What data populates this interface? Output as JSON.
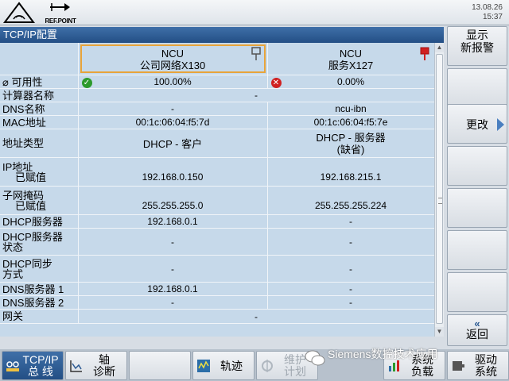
{
  "topbar": {
    "refpoint_label": "REF.POINT",
    "date": "13.08.26",
    "time": "15:37"
  },
  "title": "TCP/IP配置",
  "table": {
    "col1_header": [
      "NCU",
      "公司网络X130"
    ],
    "col2_header": [
      "NCU",
      "服务X127"
    ],
    "rows": {
      "availability": {
        "label": "⌀ 可用性",
        "v1": "100.00%",
        "v2": "0.00%"
      },
      "computer_name": {
        "label": "计算器名称",
        "v": "-"
      },
      "dns_name": {
        "label": "DNS名称",
        "v1": "-",
        "v2": "ncu-ibn"
      },
      "mac": {
        "label": "MAC地址",
        "v1": "00:1c:06:04:f5:7d",
        "v2": "00:1c:06:04:f5:7e"
      },
      "addr_type": {
        "label": "地址类型",
        "v1": "DHCP - 客户",
        "v2a": "DHCP - 服务器",
        "v2b": "(缺省)"
      },
      "ip": {
        "label1": "IP地址",
        "label2": "已赋值",
        "v1": "192.168.0.150",
        "v2": "192.168.215.1"
      },
      "subnet": {
        "label1": "子网掩码",
        "label2": "已赋值",
        "v1": "255.255.255.0",
        "v2": "255.255.255.224"
      },
      "dhcp_server": {
        "label": "DHCP服务器",
        "v1": "192.168.0.1",
        "v2": "-"
      },
      "dhcp_state": {
        "label1": "DHCP服务器",
        "label2": "状态",
        "v1": "-",
        "v2": "-"
      },
      "dhcp_sync": {
        "label1": "DHCP同步",
        "label2": "方式",
        "v1": "-",
        "v2": "-"
      },
      "dns1": {
        "label": "DNS服务器 1",
        "v1": "192.168.0.1",
        "v2": "-"
      },
      "dns2": {
        "label": "DNS服务器 2",
        "v1": "-",
        "v2": "-"
      },
      "gateway": {
        "label": "网关",
        "v": "-"
      }
    }
  },
  "right_softkeys": {
    "show_alarms": [
      "显示",
      "新报警"
    ],
    "change": "更改",
    "back": "返回",
    "back_symbol": "«"
  },
  "bottom_softkeys": {
    "tcpip": [
      "TCP/IP",
      "总 线"
    ],
    "axis_diag": [
      "轴",
      "诊断"
    ],
    "trace": "轨迹",
    "maintenance": [
      "维护",
      "计划"
    ],
    "sys_load": [
      "系统",
      "负载"
    ],
    "drive_sys": [
      "驱动",
      "系统"
    ]
  },
  "watermark": "Siemens数控技术应用",
  "colors": {
    "title_bg": "#2c5a92",
    "table_bg": "#c6d9ea",
    "ok": "#2c9a2c",
    "error": "#d02020",
    "highlight_border": "#e8a43a"
  }
}
